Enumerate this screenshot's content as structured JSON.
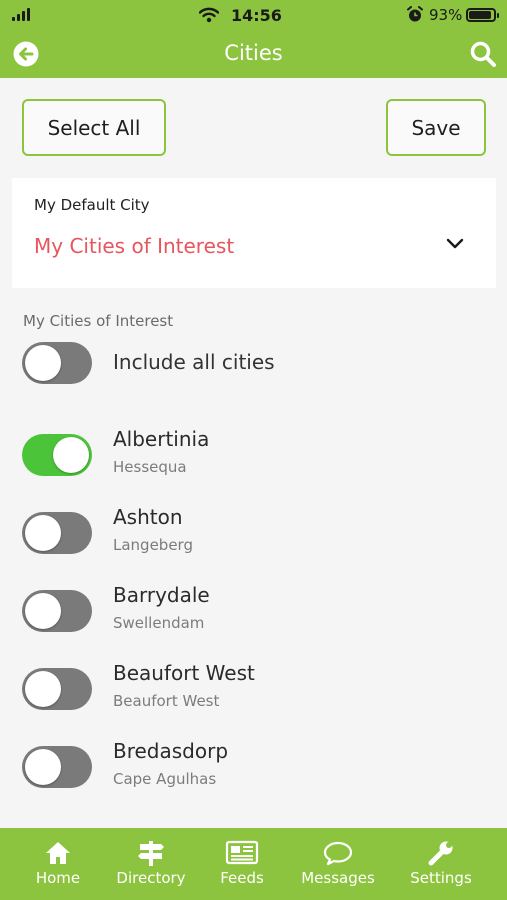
{
  "status_bar": {
    "time": "14:56",
    "battery": "93%",
    "battery_level": 0.93
  },
  "header": {
    "title": "Cities",
    "back_icon": "back-arrow-circle-icon",
    "search_icon": "search-icon"
  },
  "actions": {
    "select_all_label": "Select All",
    "save_label": "Save"
  },
  "default_city": {
    "label": "My Default City",
    "value": "My Cities of Interest",
    "value_color": "#e8555c"
  },
  "section": {
    "label": "My Cities of Interest"
  },
  "include_all": {
    "label": "Include all cities",
    "on": false
  },
  "cities": [
    {
      "name": "Albertinia",
      "region": "Hessequa",
      "on": true
    },
    {
      "name": "Ashton",
      "region": "Langeberg",
      "on": false
    },
    {
      "name": "Barrydale",
      "region": "Swellendam",
      "on": false
    },
    {
      "name": "Beaufort West",
      "region": "Beaufort West",
      "on": false
    },
    {
      "name": "Bredasdorp",
      "region": "Cape Agulhas",
      "on": false
    }
  ],
  "tabs": [
    {
      "label": "Home",
      "icon": "home-icon"
    },
    {
      "label": "Directory",
      "icon": "signpost-icon"
    },
    {
      "label": "Feeds",
      "icon": "newspaper-icon"
    },
    {
      "label": "Messages",
      "icon": "chat-bubble-icon"
    },
    {
      "label": "Settings",
      "icon": "wrench-icon"
    }
  ],
  "colors": {
    "brand": "#8dc43f",
    "toggle_on": "#4cc43a",
    "toggle_off": "#7a7a7a",
    "accent_text": "#e8555c"
  }
}
